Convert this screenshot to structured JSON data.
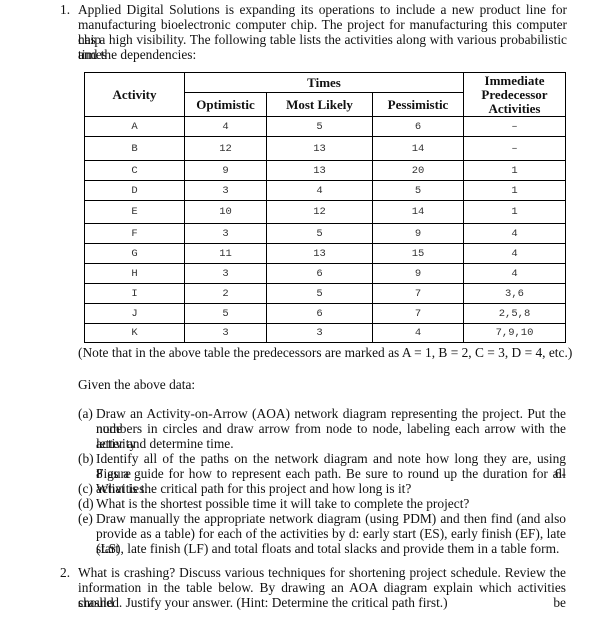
{
  "q1": {
    "number": "1.",
    "intro_lines": [
      "Applied Digital Solutions is expanding its operations to include a new product line for",
      "manufacturing bioelectronic computer chip.  The project for manufacturing this computer chip",
      "has a high visibility.  The following table lists the activities along with various probabilistic times",
      "and the dependencies:"
    ],
    "table": {
      "headers": {
        "activity": "Activity",
        "times": "Times",
        "optimistic": "Optimistic",
        "most_likely": "Most Likely",
        "pessimistic": "Pessimistic",
        "predecessor_lines": [
          "Immediate",
          "Predecessor",
          "Activities"
        ]
      },
      "rows": [
        {
          "activity": "A",
          "optimistic": "4",
          "most_likely": "5",
          "pessimistic": "6",
          "predecessors": "–"
        },
        {
          "activity": "B",
          "optimistic": "12",
          "most_likely": "13",
          "pessimistic": "14",
          "predecessors": "–"
        },
        {
          "activity": "C",
          "optimistic": "9",
          "most_likely": "13",
          "pessimistic": "20",
          "predecessors": "1"
        },
        {
          "activity": "D",
          "optimistic": "3",
          "most_likely": "4",
          "pessimistic": "5",
          "predecessors": "1"
        },
        {
          "activity": "E",
          "optimistic": "10",
          "most_likely": "12",
          "pessimistic": "14",
          "predecessors": "1"
        },
        {
          "activity": "F",
          "optimistic": "3",
          "most_likely": "5",
          "pessimistic": "9",
          "predecessors": "4"
        },
        {
          "activity": "G",
          "optimistic": "11",
          "most_likely": "13",
          "pessimistic": "15",
          "predecessors": "4"
        },
        {
          "activity": "H",
          "optimistic": "3",
          "most_likely": "6",
          "pessimistic": "9",
          "predecessors": "4"
        },
        {
          "activity": "I",
          "optimistic": "2",
          "most_likely": "5",
          "pessimistic": "7",
          "predecessors": "3,6"
        },
        {
          "activity": "J",
          "optimistic": "5",
          "most_likely": "6",
          "pessimistic": "7",
          "predecessors": "2,5,8"
        },
        {
          "activity": "K",
          "optimistic": "3",
          "most_likely": "3",
          "pessimistic": "4",
          "predecessors": "7,9,10"
        }
      ]
    },
    "note": "(Note that in the above table the predecessors are marked as A = 1, B = 2, C = 3, D = 4, etc.)",
    "given": "Given the above data:",
    "parts": [
      {
        "label": "(a)",
        "lines": [
          "Draw an Activity-on-Arrow (AOA) network diagram representing the project.  Put the node",
          "numbers in circles and draw arrow from node to node, labeling each arrow with the activity",
          "letter and determine time."
        ]
      },
      {
        "label": "(b)",
        "lines": [
          "Identify all of the paths on the network diagram and note how long they are, using Figure 6-",
          "8 as a guide for how to represent each path. Be sure to round up the duration for all activities."
        ]
      },
      {
        "label": "(c)",
        "lines": [
          "What is the critical path for this project and how long is it?"
        ]
      },
      {
        "label": "(d)",
        "lines": [
          "What is the shortest possible time it will take to complete the project?"
        ]
      },
      {
        "label": "(e)",
        "lines": [
          "Draw manually the appropriate network diagram (using PDM) and then find (and also",
          "provide as a table) for each of the activities by d: early start (ES), early finish (EF), late start",
          "(LS), late finish (LF) and total floats and total slacks and provide them in a table form."
        ]
      }
    ]
  },
  "q2": {
    "number": "2.",
    "lines": [
      "What is crashing?  Discuss various techniques for shortening project schedule. Review the",
      "information in the table below.  By drawing an AOA diagram explain which activities should be",
      "crashed. Justify your answer. (Hint: Determine the critical path first.)"
    ]
  }
}
